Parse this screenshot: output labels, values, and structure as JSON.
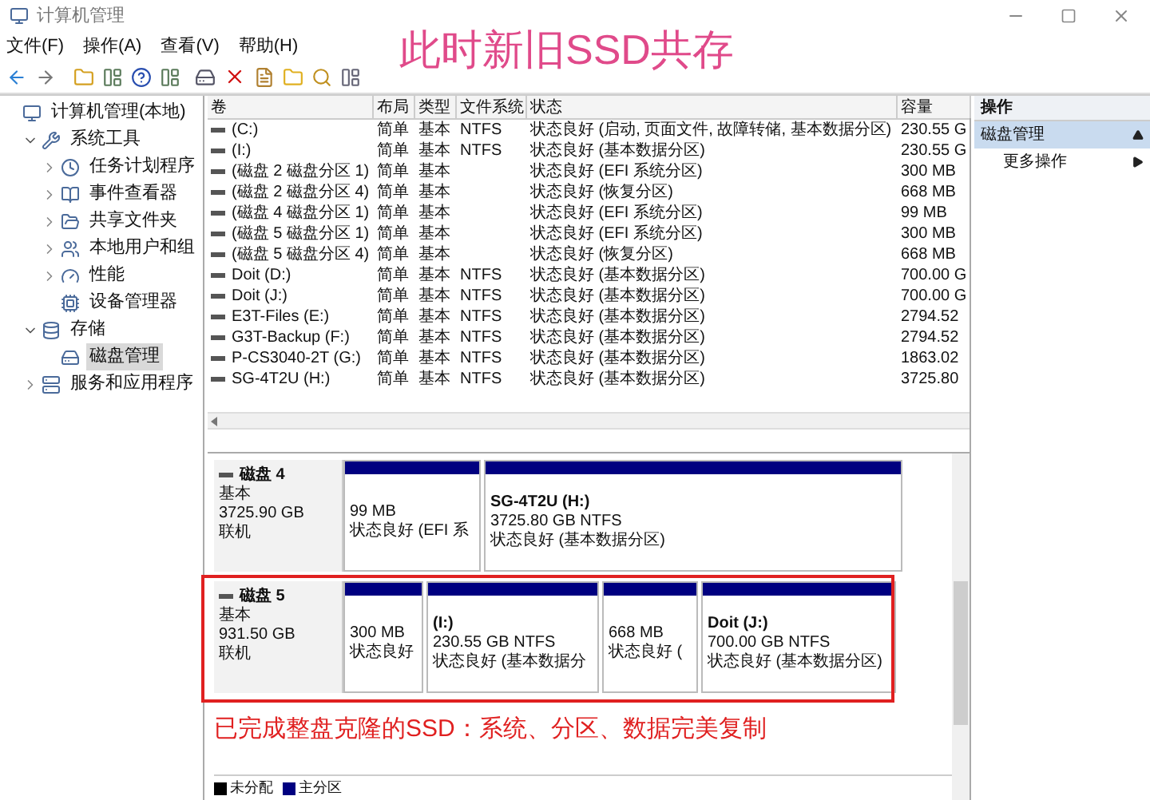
{
  "window": {
    "title": "计算机管理",
    "annotation": "此时新旧SSD共存"
  },
  "menu": [
    "文件(F)",
    "操作(A)",
    "查看(V)",
    "帮助(H)"
  ],
  "tree": [
    {
      "label": "计算机管理(本地)",
      "selected": false,
      "children": [
        {
          "label": "系统工具",
          "expanded": true,
          "selected": false,
          "children": [
            {
              "label": "任务计划程序",
              "expanded": false,
              "selected": false
            },
            {
              "label": "事件查看器",
              "expanded": false,
              "selected": false
            },
            {
              "label": "共享文件夹",
              "expanded": false,
              "selected": false
            },
            {
              "label": "本地用户和组",
              "expanded": false,
              "selected": false
            },
            {
              "label": "性能",
              "expanded": false,
              "selected": false
            },
            {
              "label": "设备管理器",
              "selected": false
            }
          ]
        },
        {
          "label": "存储",
          "expanded": true,
          "selected": false,
          "children": [
            {
              "label": "磁盘管理",
              "selected": true
            }
          ]
        },
        {
          "label": "服务和应用程序",
          "expanded": false,
          "selected": false
        }
      ]
    }
  ],
  "table": {
    "columns": [
      "卷",
      "布局",
      "类型",
      "文件系统",
      "状态",
      "容量"
    ],
    "rows": [
      [
        "(C:)",
        "简单",
        "基本",
        "NTFS",
        "状态良好 (启动, 页面文件, 故障转储, 基本数据分区)",
        "230.55 G"
      ],
      [
        "(I:)",
        "简单",
        "基本",
        "NTFS",
        "状态良好 (基本数据分区)",
        "230.55 G"
      ],
      [
        "(磁盘 2 磁盘分区 1)",
        "简单",
        "基本",
        "",
        "状态良好 (EFI 系统分区)",
        "300 MB"
      ],
      [
        "(磁盘 2 磁盘分区 4)",
        "简单",
        "基本",
        "",
        "状态良好 (恢复分区)",
        "668 MB"
      ],
      [
        "(磁盘 4 磁盘分区 1)",
        "简单",
        "基本",
        "",
        "状态良好 (EFI 系统分区)",
        "99 MB"
      ],
      [
        "(磁盘 5 磁盘分区 1)",
        "简单",
        "基本",
        "",
        "状态良好 (EFI 系统分区)",
        "300 MB"
      ],
      [
        "(磁盘 5 磁盘分区 4)",
        "简单",
        "基本",
        "",
        "状态良好 (恢复分区)",
        "668 MB"
      ],
      [
        "Doit (D:)",
        "简单",
        "基本",
        "NTFS",
        "状态良好 (基本数据分区)",
        "700.00 G"
      ],
      [
        "Doit (J:)",
        "简单",
        "基本",
        "NTFS",
        "状态良好 (基本数据分区)",
        "700.00 G"
      ],
      [
        "E3T-Files (E:)",
        "简单",
        "基本",
        "NTFS",
        "状态良好 (基本数据分区)",
        "2794.52"
      ],
      [
        "G3T-Backup (F:)",
        "简单",
        "基本",
        "NTFS",
        "状态良好 (基本数据分区)",
        "2794.52"
      ],
      [
        "P-CS3040-2T (G:)",
        "简单",
        "基本",
        "NTFS",
        "状态良好 (基本数据分区)",
        "1863.02"
      ],
      [
        "SG-4T2U (H:)",
        "简单",
        "基本",
        "NTFS",
        "状态良好 (基本数据分区)",
        "3725.80"
      ]
    ]
  },
  "disks": [
    {
      "name": "磁盘 4",
      "type": "基本",
      "size": "3725.90 GB",
      "status": "联机",
      "highlighted": false,
      "partitions": [
        {
          "size": "99 MB",
          "status": "状态良好 (EFI 系"
        },
        {
          "label": "SG-4T2U  (H:)",
          "size": "3725.80 GB NTFS",
          "status": "状态良好 (基本数据分区)"
        }
      ]
    },
    {
      "name": "磁盘 5",
      "type": "基本",
      "size": "931.50 GB",
      "status": "联机",
      "highlighted": true,
      "partitions": [
        {
          "size": "300 MB",
          "status": "状态良好"
        },
        {
          "label": "(I:)",
          "size": "230.55 GB NTFS",
          "status": "状态良好 (基本数据分"
        },
        {
          "size": "668 MB",
          "status": "状态良好 ("
        },
        {
          "label": "Doit  (J:)",
          "size": "700.00 GB NTFS",
          "status": "状态良好 (基本数据分区)"
        }
      ]
    }
  ],
  "caption": "已完成整盘克隆的SSD：系统、分区、数据完美复制",
  "legend": [
    {
      "label": "未分配",
      "color": "#000000"
    },
    {
      "label": "主分区",
      "color": "#000080"
    }
  ],
  "actions": {
    "header": "操作",
    "items": [
      {
        "label": "磁盘管理",
        "kind": "group"
      },
      {
        "label": "更多操作",
        "kind": "item"
      }
    ]
  }
}
